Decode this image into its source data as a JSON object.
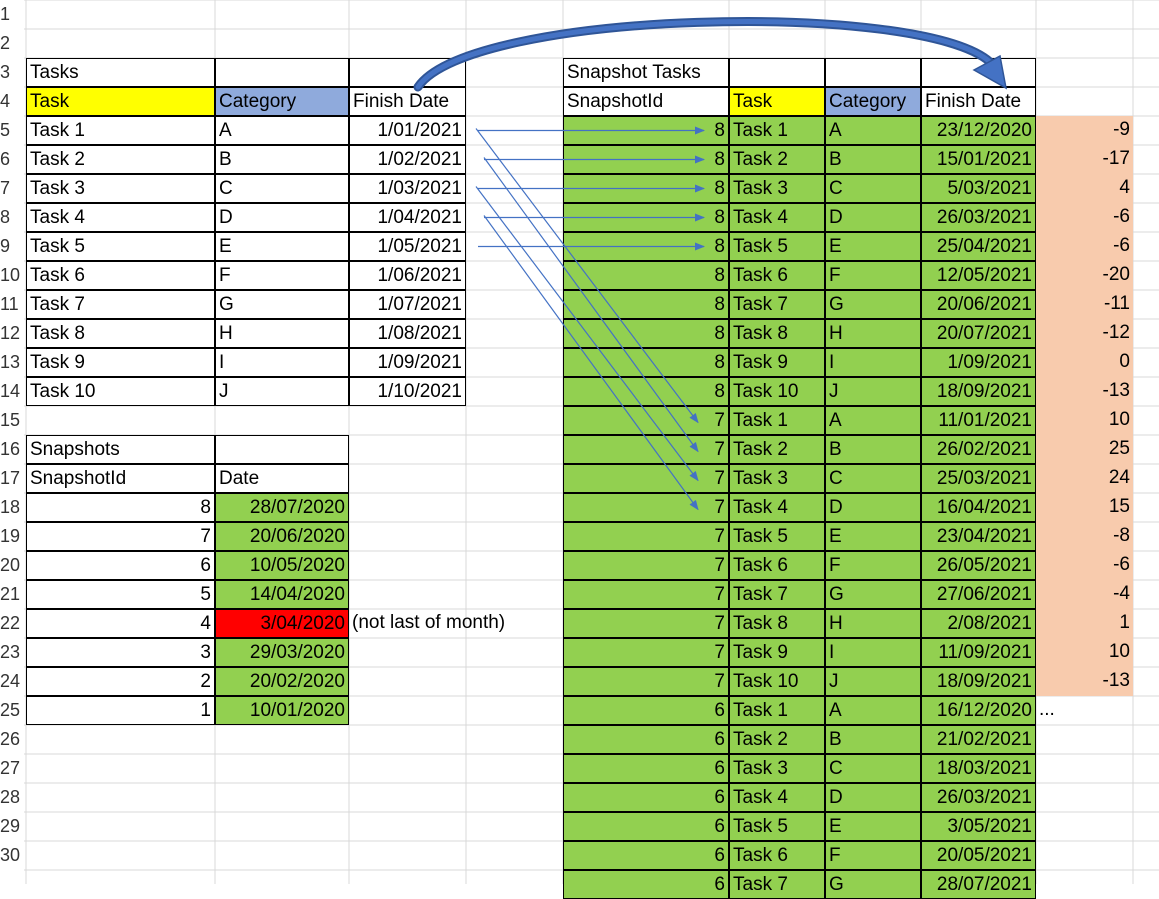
{
  "colors": {
    "yellow": "#ffff00",
    "blue_header": "#8faadc",
    "green": "#92d050",
    "red": "#ff0000",
    "peach": "#f8cbad",
    "arrow": "#4472c4",
    "big_arrow": "#2f5597"
  },
  "row_numbers": [
    "1",
    "2",
    "3",
    "4",
    "5",
    "6",
    "7",
    "8",
    "9",
    "10",
    "11",
    "12",
    "13",
    "14",
    "15",
    "16",
    "17",
    "18",
    "19",
    "20",
    "21",
    "22",
    "23",
    "24",
    "25",
    "26",
    "27",
    "28",
    "29",
    "30"
  ],
  "tasks_table": {
    "title": "Tasks",
    "headers": {
      "task": "Task",
      "category": "Category",
      "finish_date": "Finish Date"
    },
    "rows": [
      {
        "task": "Task 1",
        "category": "A",
        "finish": "1/01/2021"
      },
      {
        "task": "Task 2",
        "category": "B",
        "finish": "1/02/2021"
      },
      {
        "task": "Task 3",
        "category": "C",
        "finish": "1/03/2021"
      },
      {
        "task": "Task 4",
        "category": "D",
        "finish": "1/04/2021"
      },
      {
        "task": "Task 5",
        "category": "E",
        "finish": "1/05/2021"
      },
      {
        "task": "Task 6",
        "category": "F",
        "finish": "1/06/2021"
      },
      {
        "task": "Task 7",
        "category": "G",
        "finish": "1/07/2021"
      },
      {
        "task": "Task 8",
        "category": "H",
        "finish": "1/08/2021"
      },
      {
        "task": "Task 9",
        "category": "I",
        "finish": "1/09/2021"
      },
      {
        "task": "Task 10",
        "category": "J",
        "finish": "1/10/2021"
      }
    ]
  },
  "snapshots_table": {
    "title": "Snapshots",
    "headers": {
      "id": "SnapshotId",
      "date": "Date"
    },
    "note": "(not last of month)",
    "rows": [
      {
        "id": "8",
        "date": "28/07/2020",
        "status": "ok"
      },
      {
        "id": "7",
        "date": "20/06/2020",
        "status": "ok"
      },
      {
        "id": "6",
        "date": "10/05/2020",
        "status": "ok"
      },
      {
        "id": "5",
        "date": "14/04/2020",
        "status": "ok"
      },
      {
        "id": "4",
        "date": "3/04/2020",
        "status": "error"
      },
      {
        "id": "3",
        "date": "29/03/2020",
        "status": "ok"
      },
      {
        "id": "2",
        "date": "20/02/2020",
        "status": "ok"
      },
      {
        "id": "1",
        "date": "10/01/2020",
        "status": "ok"
      }
    ]
  },
  "snapshot_tasks_table": {
    "title": "Snapshot Tasks",
    "headers": {
      "id": "SnapshotId",
      "task": "Task",
      "category": "Category",
      "finish_date": "Finish Date"
    },
    "ellipsis": "...",
    "partial_row": {
      "id": "6",
      "task": "Task 7",
      "category": "G",
      "finish": "28/07/2021"
    },
    "rows": [
      {
        "id": "8",
        "task": "Task 1",
        "category": "A",
        "finish": "23/12/2020",
        "diff": "-9"
      },
      {
        "id": "8",
        "task": "Task 2",
        "category": "B",
        "finish": "15/01/2021",
        "diff": "-17"
      },
      {
        "id": "8",
        "task": "Task 3",
        "category": "C",
        "finish": "5/03/2021",
        "diff": "4"
      },
      {
        "id": "8",
        "task": "Task 4",
        "category": "D",
        "finish": "26/03/2021",
        "diff": "-6"
      },
      {
        "id": "8",
        "task": "Task 5",
        "category": "E",
        "finish": "25/04/2021",
        "diff": "-6"
      },
      {
        "id": "8",
        "task": "Task 6",
        "category": "F",
        "finish": "12/05/2021",
        "diff": "-20"
      },
      {
        "id": "8",
        "task": "Task 7",
        "category": "G",
        "finish": "20/06/2021",
        "diff": "-11"
      },
      {
        "id": "8",
        "task": "Task 8",
        "category": "H",
        "finish": "20/07/2021",
        "diff": "-12"
      },
      {
        "id": "8",
        "task": "Task 9",
        "category": "I",
        "finish": "1/09/2021",
        "diff": "0"
      },
      {
        "id": "8",
        "task": "Task 10",
        "category": "J",
        "finish": "18/09/2021",
        "diff": "-13"
      },
      {
        "id": "7",
        "task": "Task 1",
        "category": "A",
        "finish": "11/01/2021",
        "diff": "10"
      },
      {
        "id": "7",
        "task": "Task 2",
        "category": "B",
        "finish": "26/02/2021",
        "diff": "25"
      },
      {
        "id": "7",
        "task": "Task 3",
        "category": "C",
        "finish": "25/03/2021",
        "diff": "24"
      },
      {
        "id": "7",
        "task": "Task 4",
        "category": "D",
        "finish": "16/04/2021",
        "diff": "15"
      },
      {
        "id": "7",
        "task": "Task 5",
        "category": "E",
        "finish": "23/04/2021",
        "diff": "-8"
      },
      {
        "id": "7",
        "task": "Task 6",
        "category": "F",
        "finish": "26/05/2021",
        "diff": "-6"
      },
      {
        "id": "7",
        "task": "Task 7",
        "category": "G",
        "finish": "27/06/2021",
        "diff": "-4"
      },
      {
        "id": "7",
        "task": "Task 8",
        "category": "H",
        "finish": "2/08/2021",
        "diff": "1"
      },
      {
        "id": "7",
        "task": "Task 9",
        "category": "I",
        "finish": "11/09/2021",
        "diff": "10"
      },
      {
        "id": "7",
        "task": "Task 10",
        "category": "J",
        "finish": "18/09/2021",
        "diff": "-13"
      },
      {
        "id": "6",
        "task": "Task 1",
        "category": "A",
        "finish": "16/12/2020",
        "diff": ""
      },
      {
        "id": "6",
        "task": "Task 2",
        "category": "B",
        "finish": "21/02/2021",
        "diff": ""
      },
      {
        "id": "6",
        "task": "Task 3",
        "category": "C",
        "finish": "18/03/2021",
        "diff": ""
      },
      {
        "id": "6",
        "task": "Task 4",
        "category": "D",
        "finish": "26/03/2021",
        "diff": ""
      },
      {
        "id": "6",
        "task": "Task 5",
        "category": "E",
        "finish": "3/05/2021",
        "diff": ""
      },
      {
        "id": "6",
        "task": "Task 6",
        "category": "F",
        "finish": "20/05/2021",
        "diff": ""
      }
    ]
  }
}
